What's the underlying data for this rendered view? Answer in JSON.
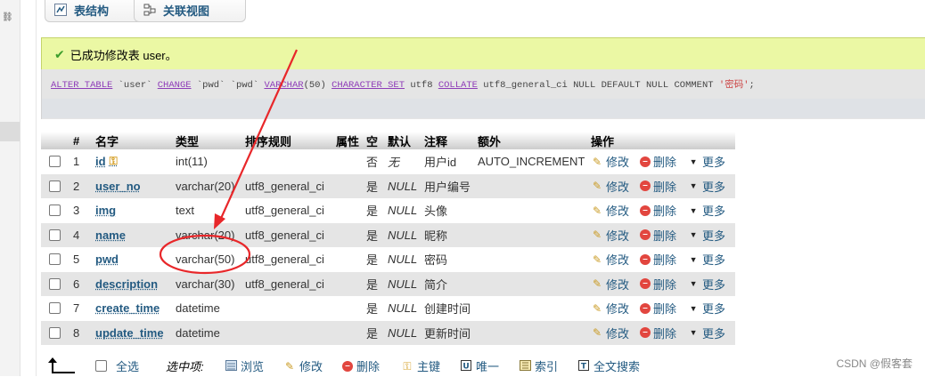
{
  "tabs": [
    {
      "label": "表结构",
      "icon": "structure-icon"
    },
    {
      "label": "关联视图",
      "icon": "relation-view-icon"
    }
  ],
  "message": {
    "text": "已成功修改表 user。",
    "sql": {
      "p1": "ALTER TABLE",
      "p2": " `user` ",
      "p3": "CHANGE",
      "p4": " `pwd` `pwd` ",
      "p5": "VARCHAR",
      "p6": "(50) ",
      "p7": "CHARACTER SET",
      "p8": " utf8 ",
      "p9": "COLLATE",
      "p10": " utf8_general_ci ",
      "p11": "NULL DEFAULT NULL COMMENT",
      "p12": " '密码'",
      "p13": ";"
    }
  },
  "table": {
    "headers": {
      "num": "#",
      "name": "名字",
      "type": "类型",
      "collation": "排序规则",
      "attributes": "属性",
      "null": "空",
      "default": "默认",
      "comment": "注释",
      "extra": "额外",
      "action": "操作"
    },
    "action_labels": {
      "edit": "修改",
      "drop": "删除",
      "more": "更多"
    },
    "rows": [
      {
        "num": "1",
        "name": "id",
        "type": "int(11)",
        "collation": "",
        "null": "否",
        "default": "无",
        "comment": "用户id",
        "extra": "AUTO_INCREMENT"
      },
      {
        "num": "2",
        "name": "user_no",
        "type": "varchar(20)",
        "collation": "utf8_general_ci",
        "null": "是",
        "default": "NULL",
        "comment": "用户编号",
        "extra": ""
      },
      {
        "num": "3",
        "name": "img",
        "type": "text",
        "collation": "utf8_general_ci",
        "null": "是",
        "default": "NULL",
        "comment": "头像",
        "extra": ""
      },
      {
        "num": "4",
        "name": "name",
        "type": "varchar(20)",
        "collation": "utf8_general_ci",
        "null": "是",
        "default": "NULL",
        "comment": "昵称",
        "extra": ""
      },
      {
        "num": "5",
        "name": "pwd",
        "type": "varchar(50)",
        "collation": "utf8_general_ci",
        "null": "是",
        "default": "NULL",
        "comment": "密码",
        "extra": ""
      },
      {
        "num": "6",
        "name": "description",
        "type": "varchar(30)",
        "collation": "utf8_general_ci",
        "null": "是",
        "default": "NULL",
        "comment": "简介",
        "extra": ""
      },
      {
        "num": "7",
        "name": "create_time",
        "type": "datetime",
        "collation": "",
        "null": "是",
        "default": "NULL",
        "comment": "创建时间",
        "extra": ""
      },
      {
        "num": "8",
        "name": "update_time",
        "type": "datetime",
        "collation": "",
        "null": "是",
        "default": "NULL",
        "comment": "更新时间",
        "extra": ""
      }
    ]
  },
  "bottom": {
    "select_all": "全选",
    "with_selected": "选中项:",
    "actions": [
      {
        "label": "浏览",
        "icon": "browse-icon"
      },
      {
        "label": "修改",
        "icon": "edit-icon"
      },
      {
        "label": "删除",
        "icon": "drop-icon"
      },
      {
        "label": "主键",
        "icon": "primary-key-icon"
      },
      {
        "label": "唯一",
        "icon": "unique-icon"
      },
      {
        "label": "索引",
        "icon": "index-icon"
      },
      {
        "label": "全文搜索",
        "icon": "fulltext-icon"
      }
    ]
  },
  "watermark": "CSDN @假客套",
  "colors": {
    "annotation": "#e8272a",
    "link": "#235a81",
    "success_bg": "#ebf8a4"
  }
}
